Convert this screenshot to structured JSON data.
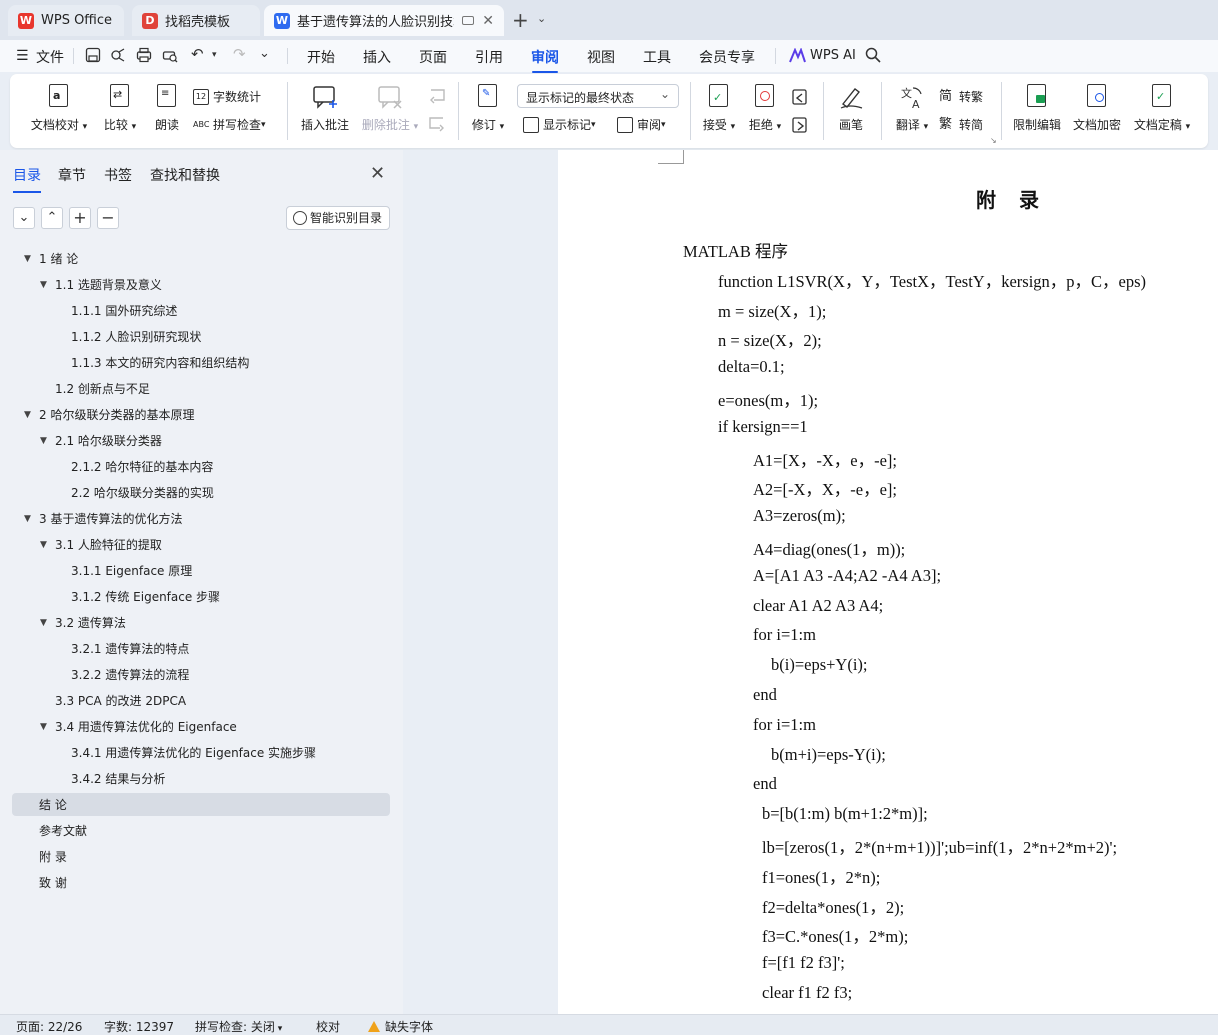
{
  "tabs": [
    {
      "label": "WPS Office",
      "logo": "W"
    },
    {
      "label": "找稻壳模板",
      "logo": "D"
    },
    {
      "label": "基于遗传算法的人脸识别技术",
      "logo": "W"
    }
  ],
  "menu": {
    "file": "文件",
    "items": [
      "开始",
      "插入",
      "页面",
      "引用",
      "审阅",
      "视图",
      "工具",
      "会员专享"
    ],
    "active": "审阅",
    "wps_ai": "WPS AI"
  },
  "ribbon": {
    "doc_check": "文档校对",
    "compare": "比较",
    "read_aloud": "朗读",
    "word_count": "字数统计",
    "spell_check": "拼写检查",
    "insert_comment": "插入批注",
    "delete_comment": "删除批注",
    "track_changes": "修订",
    "markup_state": "显示标记的最终状态",
    "show_markup": "显示标记",
    "review": "审阅",
    "accept": "接受",
    "reject": "拒绝",
    "pen": "画笔",
    "translate": "翻译",
    "to_traditional": "转繁",
    "to_simplified": "转简",
    "restrict_edit": "限制编辑",
    "encrypt": "文档加密",
    "finalize": "文档定稿"
  },
  "nav": {
    "tabs": [
      "目录",
      "章节",
      "书签",
      "查找和替换"
    ],
    "smart_toc": "智能识别目录",
    "toc": [
      {
        "label": "1  绪  论",
        "level": 1,
        "caret": true
      },
      {
        "label": "1.1  选题背景及意义",
        "level": 2,
        "caret": true
      },
      {
        "label": "1.1.1  国外研究综述",
        "level": 3,
        "caret": false
      },
      {
        "label": "1.1.2  人脸识别研究现状",
        "level": 3,
        "caret": false
      },
      {
        "label": "1.1.3 本文的研究内容和组织结构",
        "level": 3,
        "caret": false
      },
      {
        "label": "1.2  创新点与不足",
        "level": 2,
        "caret": false
      },
      {
        "label": "2 哈尔级联分类器的基本原理",
        "level": 1,
        "caret": true
      },
      {
        "label": "2.1 哈尔级联分类器",
        "level": 2,
        "caret": true
      },
      {
        "label": "2.1.2 哈尔特征的基本内容",
        "level": 3,
        "caret": false
      },
      {
        "label": "2.2  哈尔级联分类器的实现",
        "level": 3,
        "caret": false
      },
      {
        "label": "3 基于遗传算法的优化方法",
        "level": 1,
        "caret": true
      },
      {
        "label": "3.1 人脸特征的提取",
        "level": 2,
        "caret": true
      },
      {
        "label": "3.1.1 Eigenface 原理",
        "level": 3,
        "caret": false
      },
      {
        "label": "3.1.2 传统 Eigenface 步骤",
        "level": 3,
        "caret": false
      },
      {
        "label": "3.2  遗传算法",
        "level": 2,
        "caret": true
      },
      {
        "label": "3.2.1 遗传算法的特点",
        "level": 3,
        "caret": false
      },
      {
        "label": "3.2.2  遗传算法的流程",
        "level": 3,
        "caret": false
      },
      {
        "label": "3.3 PCA 的改进 2DPCA",
        "level": 2,
        "caret": false
      },
      {
        "label": "3.4  用遗传算法优化的 Eigenface",
        "level": 2,
        "caret": true
      },
      {
        "label": "3.4.1 用遗传算法优化的 Eigenface 实施步骤",
        "level": 3,
        "caret": false
      },
      {
        "label": "3.4.2  结果与分析",
        "level": 3,
        "caret": false
      },
      {
        "label": "结  论",
        "level": 1,
        "caret": false,
        "selected": true
      },
      {
        "label": "参考文献",
        "level": 1,
        "caret": false
      },
      {
        "label": "附  录",
        "level": 1,
        "caret": false
      },
      {
        "label": "致  谢",
        "level": 1,
        "caret": false
      }
    ]
  },
  "document": {
    "title": "附 录",
    "lines": [
      {
        "text": "MATLAB 程序",
        "indent": 0
      },
      {
        "text": "function L1SVR(X，Y，TestX，TestY，kersign，p，C，eps)",
        "indent": 1
      },
      {
        "text": "m = size(X，1);",
        "indent": 1
      },
      {
        "text": "n = size(X，2);",
        "indent": 1
      },
      {
        "text": "delta=0.1;",
        "indent": 1
      },
      {
        "text": "e=ones(m，1);",
        "indent": 1
      },
      {
        "text": "if kersign==1",
        "indent": 1
      },
      {
        "text": "A1=[X，-X，e，-e];",
        "indent": 2
      },
      {
        "text": "A2=[-X，X，-e，e];",
        "indent": 2
      },
      {
        "text": "A3=zeros(m);",
        "indent": 2
      },
      {
        "text": "A4=diag(ones(1，m));",
        "indent": 2
      },
      {
        "text": "A=[A1 A3 -A4;A2 -A4 A3];",
        "indent": 2
      },
      {
        "text": "clear A1 A2 A3 A4;",
        "indent": 2
      },
      {
        "text": "for i=1:m",
        "indent": 2
      },
      {
        "text": "b(i)=eps+Y(i);",
        "indent": 3
      },
      {
        "text": "end",
        "indent": 2
      },
      {
        "text": "for i=1:m",
        "indent": 2
      },
      {
        "text": "b(m+i)=eps-Y(i);",
        "indent": 3
      },
      {
        "text": "end",
        "indent": 2
      },
      {
        "text": "b=[b(1:m) b(m+1:2*m)];",
        "indent": 4
      },
      {
        "text": "lb=[zeros(1，2*(n+m+1))]';ub=inf(1，2*n+2*m+2)';",
        "indent": 4
      },
      {
        "text": "f1=ones(1，2*n);",
        "indent": 4
      },
      {
        "text": "f2=delta*ones(1，2);",
        "indent": 4
      },
      {
        "text": "f3=C.*ones(1，2*m);",
        "indent": 4
      },
      {
        "text": "f=[f1 f2 f3]';",
        "indent": 4
      },
      {
        "text": "clear f1 f2 f3;",
        "indent": 4
      }
    ]
  },
  "status": {
    "page": "页面: 22/26",
    "words": "字数: 12397",
    "spell": "拼写检查: 关闭",
    "proof": "校对",
    "missing_font": "缺失字体"
  },
  "colors": {
    "accent": "#1a56e8",
    "wps_red": "#e8362d",
    "docer_red": "#e0433a"
  }
}
